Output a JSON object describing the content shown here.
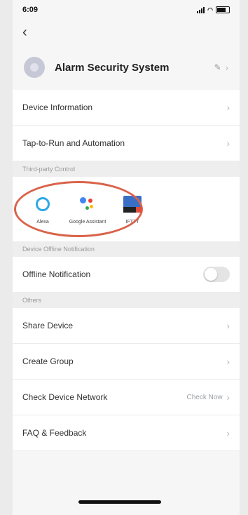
{
  "status_bar": {
    "time": "6:09"
  },
  "header": {
    "back_icon": "back-chevron-icon"
  },
  "device": {
    "name": "Alarm Security System",
    "edit_icon": "pencil-icon"
  },
  "rows_top": [
    {
      "label": "Device Information"
    },
    {
      "label": "Tap-to-Run and Automation"
    }
  ],
  "third_party": {
    "section_title": "Third-party Control",
    "items": [
      {
        "label": "Alexa",
        "icon": "alexa-icon"
      },
      {
        "label": "Google Assistant",
        "icon": "google-assistant-icon"
      },
      {
        "label": "IFTTT",
        "icon": "ifttt-icon"
      }
    ],
    "highlight_color": "#d9634a"
  },
  "offline_section": {
    "title": "Device Offline Notification",
    "label": "Offline Notification",
    "toggle_on": false
  },
  "others_section": {
    "title": "Others",
    "rows": [
      {
        "label": "Share Device",
        "value": ""
      },
      {
        "label": "Create Group",
        "value": ""
      },
      {
        "label": "Check Device Network",
        "value": "Check Now"
      },
      {
        "label": "FAQ & Feedback",
        "value": ""
      }
    ]
  }
}
